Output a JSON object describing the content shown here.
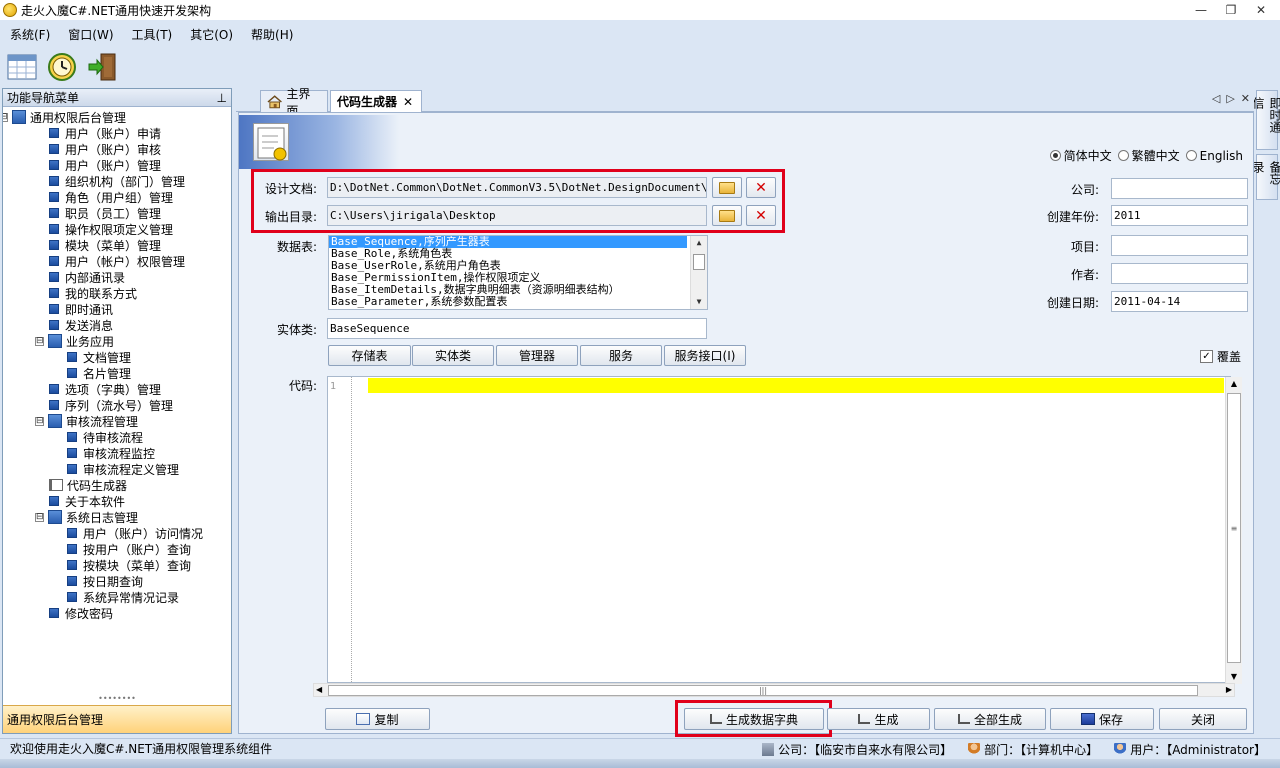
{
  "window": {
    "title": "走火入魔C#.NET通用快速开发架构",
    "controls": [
      "—",
      "❐",
      "✕"
    ]
  },
  "menu": [
    "系统(F)",
    "窗口(W)",
    "工具(T)",
    "其它(O)",
    "帮助(H)"
  ],
  "toolbar": {
    "icons": [
      "spreadsheet-icon",
      "clock-icon",
      "exit-door-icon"
    ]
  },
  "nav": {
    "header": "功能导航菜单",
    "pin": "⊥",
    "tree": [
      {
        "label": "通用权限后台管理",
        "level": 0,
        "type": "folder",
        "expander": "⊟"
      },
      {
        "label": "用户（账户）申请",
        "level": 1,
        "type": "leaf"
      },
      {
        "label": "用户（账户）审核",
        "level": 1,
        "type": "leaf"
      },
      {
        "label": "用户（账户）管理",
        "level": 1,
        "type": "leaf"
      },
      {
        "label": "组织机构（部门）管理",
        "level": 1,
        "type": "leaf"
      },
      {
        "label": "角色（用户组）管理",
        "level": 1,
        "type": "leaf"
      },
      {
        "label": "职员（员工）管理",
        "level": 1,
        "type": "leaf"
      },
      {
        "label": "操作权限项定义管理",
        "level": 1,
        "type": "leaf"
      },
      {
        "label": "模块（菜单）管理",
        "level": 1,
        "type": "leaf"
      },
      {
        "label": "用户（帐户）权限管理",
        "level": 1,
        "type": "leaf"
      },
      {
        "label": "内部通讯录",
        "level": 1,
        "type": "leaf"
      },
      {
        "label": "我的联系方式",
        "level": 1,
        "type": "leaf"
      },
      {
        "label": "即时通讯",
        "level": 1,
        "type": "leaf"
      },
      {
        "label": "发送消息",
        "level": 1,
        "type": "leaf"
      },
      {
        "label": "业务应用",
        "level": 1,
        "type": "folder",
        "expander": "⊟"
      },
      {
        "label": "文档管理",
        "level": 2,
        "type": "leaf"
      },
      {
        "label": "名片管理",
        "level": 2,
        "type": "leaf"
      },
      {
        "label": "选项（字典）管理",
        "level": 1,
        "type": "leaf"
      },
      {
        "label": "序列（流水号）管理",
        "level": 1,
        "type": "leaf"
      },
      {
        "label": "审核流程管理",
        "level": 1,
        "type": "folder",
        "expander": "⊟"
      },
      {
        "label": "待审核流程",
        "level": 2,
        "type": "leaf"
      },
      {
        "label": "审核流程监控",
        "level": 2,
        "type": "leaf"
      },
      {
        "label": "审核流程定义管理",
        "level": 2,
        "type": "leaf"
      },
      {
        "label": "代码生成器",
        "level": 1,
        "type": "book"
      },
      {
        "label": "关于本软件",
        "level": 1,
        "type": "leaf"
      },
      {
        "label": "系统日志管理",
        "level": 1,
        "type": "folder",
        "expander": "⊟"
      },
      {
        "label": "用户（账户）访问情况",
        "level": 2,
        "type": "leaf"
      },
      {
        "label": "按用户（账户）查询",
        "level": 2,
        "type": "leaf"
      },
      {
        "label": "按模块（菜单）查询",
        "level": 2,
        "type": "leaf"
      },
      {
        "label": "按日期查询",
        "level": 2,
        "type": "leaf"
      },
      {
        "label": "系统异常情况记录",
        "level": 2,
        "type": "leaf"
      },
      {
        "label": "修改密码",
        "level": 1,
        "type": "leaf"
      }
    ],
    "grip": "••••••••",
    "footer": "通用权限后台管理"
  },
  "sidetabs": [
    "即时通信",
    "备忘录"
  ],
  "tabs": {
    "main": "主界面",
    "active": "代码生成器",
    "close": "✕",
    "nav": [
      "◁",
      "▷",
      "✕"
    ]
  },
  "form": {
    "design_doc_label": "设计文档:",
    "design_doc_value": "D:\\DotNet.Common\\DotNet.CommonV3.5\\DotNet.DesignDocument\\DotNet",
    "output_dir_label": "输出目录:",
    "output_dir_value": "C:\\Users\\jirigala\\Desktop",
    "table_label": "数据表:",
    "tables": [
      "Base_Sequence,序列产生器表",
      "Base_Role,系统角色表",
      "Base_UserRole,系统用户角色表",
      "Base_PermissionItem,操作权限项定义",
      "Base_ItemDetails,数据字典明细表（资源明细表结构）",
      "Base_Parameter,系统参数配置表"
    ],
    "entity_label": "实体类:",
    "entity_value": "BaseSequence",
    "code_label": "代码:",
    "line_number": "1",
    "languages": [
      "简体中文",
      "繁體中文",
      "English"
    ],
    "selected_language": 0,
    "company_label": "公司:",
    "company_value": "",
    "year_label": "创建年份:",
    "year_value": "2011",
    "project_label": "项目:",
    "project_value": "",
    "author_label": "作者:",
    "author_value": "",
    "date_label": "创建日期:",
    "date_value": "2011-04-14",
    "gen_types": [
      "存储表",
      "实体类",
      "管理器",
      "服务",
      "服务接口(I)"
    ],
    "overwrite_label": "覆盖",
    "overwrite_checked": "✓",
    "remove_x": "✕",
    "scroll_up": "▲",
    "scroll_down": "▼",
    "scroll_left": "◀",
    "scroll_right": "▶",
    "grip_v": "≡",
    "grip_h": "|||"
  },
  "buttons": {
    "copy": "复制",
    "gen_dict": "生成数据字典",
    "generate": "生成",
    "generate_all": "全部生成",
    "save": "保存",
    "close": "关闭"
  },
  "status": {
    "message": "欢迎使用走火入魔C#.NET通用权限管理系统组件",
    "company": "公司：【临安市自来水有限公司】",
    "department": "部门：【计算机中心】",
    "user": "用户：【Administrator】"
  },
  "colors": {
    "highlight_box": "#e0001b",
    "code_line_highlight": "#ffff00",
    "list_selection": "#3399ff"
  }
}
